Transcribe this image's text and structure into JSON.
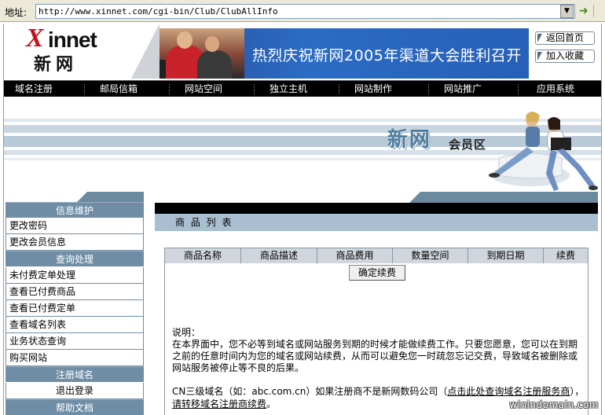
{
  "browser": {
    "address_label": "地址:",
    "url": "http://www.xinnet.com/cgi-bin/Club/ClubAllInfo"
  },
  "header": {
    "logo_x": "X",
    "logo_rest": "innet",
    "logo_cn": "新网",
    "banner_text": "热烈庆祝新网2005年渠道大会胜利召开",
    "btn_home": "返回首页",
    "btn_fav": "加入收藏"
  },
  "nav": [
    "域名注册",
    "邮局信箱",
    "网站空间",
    "独立主机",
    "网站制作",
    "网站推广",
    "应用系统"
  ],
  "member_banner": {
    "title": "新网",
    "subtitle": "会员区"
  },
  "sidebar": {
    "section_info": "信息维护",
    "change_password": "更改密码",
    "change_member_info": "更改会员信息",
    "section_query": "查询处理",
    "unpaid_orders": "未付费定单处理",
    "paid_products": "查看已付费商品",
    "paid_orders": "查看已付费定单",
    "domain_list": "查看域名列表",
    "business_status": "业务状态查询",
    "buy_website": "购买网站",
    "section_register": "注册域名",
    "logout": "退出登录",
    "section_help": "帮助文档"
  },
  "main": {
    "title": "商 品 列 表",
    "columns": [
      "商品名称",
      "商品描述",
      "商品费用",
      "数量空间",
      "到期日期",
      "续费"
    ],
    "renew_button": "确定续费",
    "note_label": "说明：",
    "note_text": "在本界面中，您不必等到域名或网站服务到期的时候才能做续费工作。只要您愿意，您可以在到期之前的任意时间内为您的域名或网站续费，从而可以避免您一时疏忽忘记交费，导致域名被删除或网站服务被停止等不良的后果。",
    "cn_text_1": "CN三级域名（如：abc.com.cn）如果注册商不是新网数码公司（",
    "cn_link_1": "点击此处查询域名注册服务商",
    "cn_text_2": "），",
    "cn_link_2": "请转移域名注册商续费",
    "cn_text_3": "。"
  },
  "watermark": "winindomain.com"
}
